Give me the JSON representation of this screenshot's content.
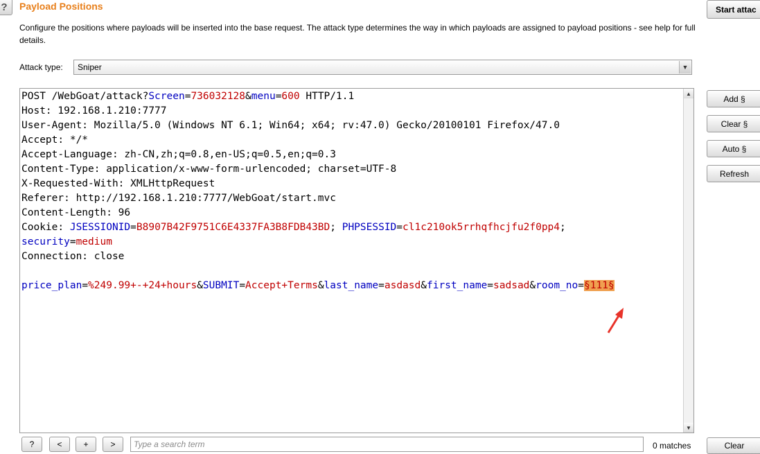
{
  "header": {
    "help_glyph": "?",
    "title": "Payload Positions",
    "description": "Configure the positions where payloads will be inserted into the base request. The attack type determines the way in which payloads are assigned to payload positions - see help for full details."
  },
  "attack_type": {
    "label": "Attack type:",
    "selected": "Sniper"
  },
  "buttons": {
    "start_attack": "Start attac",
    "add": "Add §",
    "clear": "Clear §",
    "auto": "Auto §",
    "refresh": "Refresh"
  },
  "request": {
    "l1_method": "POST /WebGoat/attack?",
    "l1_p1k": "Screen",
    "l1_p1v": "736032128",
    "l1_p2k": "menu",
    "l1_p2v": "600",
    "l1_end": " HTTP/1.1",
    "l2": "Host: 192.168.1.210:7777",
    "l3": "User-Agent: Mozilla/5.0 (Windows NT 6.1; Win64; x64; rv:47.0) Gecko/20100101 Firefox/47.0",
    "l4": "Accept: */*",
    "l5": "Accept-Language: zh-CN,zh;q=0.8,en-US;q=0.5,en;q=0.3",
    "l6": "Content-Type: application/x-www-form-urlencoded; charset=UTF-8",
    "l7": "X-Requested-With: XMLHttpRequest",
    "l8": "Referer: http://192.168.1.210:7777/WebGoat/start.mvc",
    "l9": "Content-Length: 96",
    "cookie_prefix": "Cookie: ",
    "ck1k": "JSESSIONID",
    "ck1v": "B8907B42F9751C6E4337FA3B8FDB43BD",
    "ck2k": "PHPSESSID",
    "ck2v": "cl1c210ok5rrhqfhcjfu2f0pp4",
    "ck3k": "security",
    "ck3v": "medium",
    "l11": "Connection: close",
    "b1k": "price_plan",
    "b1v": "%249.99+-+24+hours",
    "b2k": "SUBMIT",
    "b2v": "Accept+Terms",
    "b3k": "last_name",
    "b3v": "asdasd",
    "b4k": "first_name",
    "b4v": "sadsad",
    "b5k": "room_no",
    "payload": "§111§"
  },
  "search": {
    "help": "?",
    "prev": "<",
    "add": "+",
    "next": ">",
    "placeholder": "Type a search term",
    "matches": "0 matches",
    "clear": "Clear"
  },
  "colors": {
    "title": "#e8801c",
    "param_name": "#0000c0",
    "param_value": "#c00000",
    "payload_highlight": "#f0a050",
    "annotation_arrow": "#e8332a"
  }
}
